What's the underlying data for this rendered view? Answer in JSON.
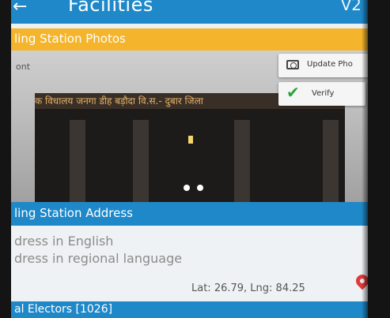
{
  "app_bar": {
    "title": "Facilities",
    "version": "V2",
    "back_glyph": "←"
  },
  "photos_section": {
    "title": "ling Station Photos",
    "front_label": "ont",
    "update_label": "Update Pho",
    "verify_label": "Verify",
    "hindi_sign": "क विधालय जनगा डीह बड़ौदा वि.स.- दुबार जिला"
  },
  "address_section": {
    "title": "ling Station Address",
    "address_english": "dress in English",
    "address_regional": "dress in regional language",
    "latlng": "Lat: 26.79, Lng: 84.25"
  },
  "electors_section": {
    "title": "al Electors [1026]"
  },
  "colors": {
    "primary_blue": "#1f88c9",
    "accent_yellow": "#f4b52d",
    "verify_green": "#29a33a",
    "pin_red": "#e23a3a"
  },
  "icons": [
    "back-arrow-icon",
    "camera-icon",
    "check-icon",
    "location-pin-icon"
  ]
}
